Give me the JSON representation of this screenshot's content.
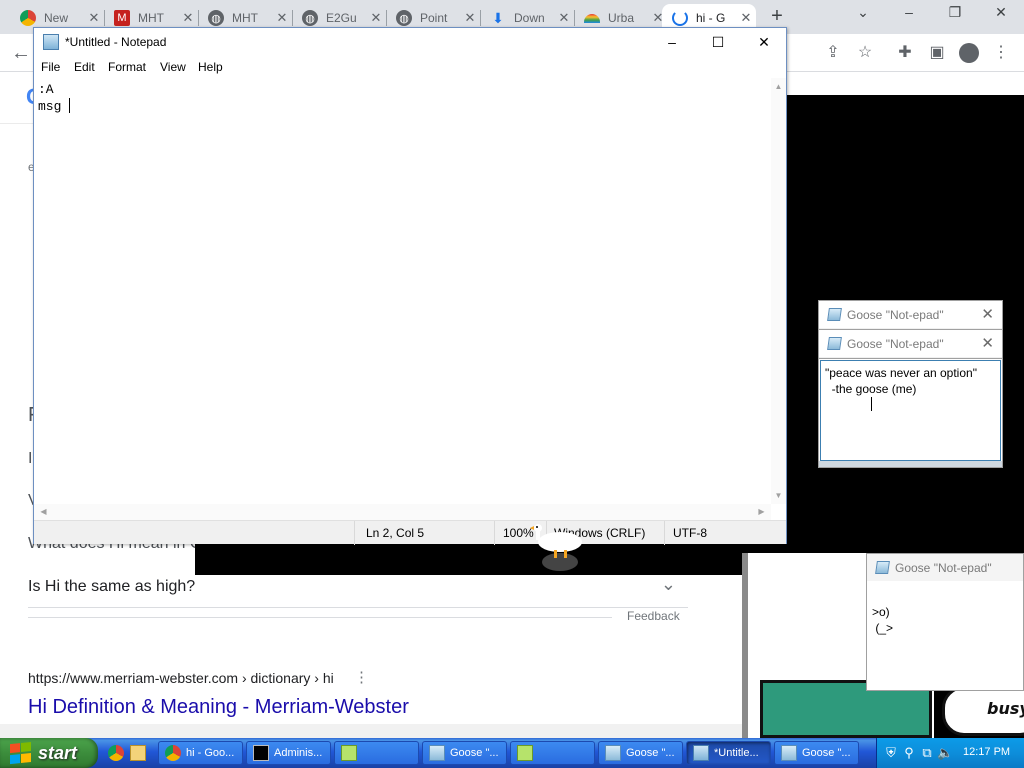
{
  "browser": {
    "tabs": [
      {
        "label": "New",
        "favicon": "chrome-icon"
      },
      {
        "label": "MHT",
        "favicon": "gmail-icon"
      },
      {
        "label": "MHT",
        "favicon": "globe-icon"
      },
      {
        "label": "E2Gu",
        "favicon": "globe-icon"
      },
      {
        "label": "Point",
        "favicon": "globe-icon"
      },
      {
        "label": "Down",
        "favicon": "download-icon"
      },
      {
        "label": "Urba",
        "favicon": "rainbow-icon"
      },
      {
        "label": "hi - G",
        "favicon": "loading-icon",
        "active": true
      }
    ],
    "new_tab": "+",
    "toolbar_icons": [
      "back-icon",
      "share-icon",
      "star-icon",
      "extensions-icon",
      "sidepanel-icon",
      "profile-icon",
      "menu-icon"
    ]
  },
  "google_page": {
    "logo_fragment": "G",
    "partial_left": [
      "e",
      "F",
      "I",
      "V"
    ],
    "partial_question": "What does Hi mean in G",
    "faq_question": "Is Hi the same as high?",
    "feedback": "Feedback",
    "result": {
      "breadcrumb": "https://www.merriam-webster.com › dictionary › hi",
      "title_part1": "Hi Definition & Meaning",
      "title_sep": " - ",
      "title_part2": "Merriam-Webster"
    }
  },
  "notepad": {
    "title": "*Untitled - Notepad",
    "menus": [
      "File",
      "Edit",
      "Format",
      "View",
      "Help"
    ],
    "content_line1": ":A",
    "content_line2": "msg ",
    "status": {
      "position": "Ln 2, Col 5",
      "zoom": "100%",
      "line_ending": "Windows (CRLF)",
      "encoding": "UTF-8"
    }
  },
  "goose_windows": {
    "title": "Goose \"Not-epad\"",
    "quote_line1": "\"peace was never an option\"",
    "quote_line2": "  -the goose (me)",
    "art_line1": ">o)",
    "art_line2": " (_>"
  },
  "game": {
    "speech_bubble": "busy"
  },
  "taskbar": {
    "start_label": "start",
    "buttons": [
      {
        "label": "hi - Goo...",
        "icon": "chrome-icon"
      },
      {
        "label": "Adminis...",
        "icon": "cmd-icon"
      },
      {
        "label": "",
        "icon": "notepad-green-icon"
      },
      {
        "label": "Goose \"...",
        "icon": "goose-notepad-icon"
      },
      {
        "label": "",
        "icon": "notepad-green-icon"
      },
      {
        "label": "Goose \"...",
        "icon": "goose-notepad-icon"
      },
      {
        "label": "*Untitle...",
        "icon": "notepad-icon",
        "active": true
      },
      {
        "label": "Goose \"...",
        "icon": "goose-notepad-icon"
      }
    ],
    "clock": "12:17 PM"
  }
}
